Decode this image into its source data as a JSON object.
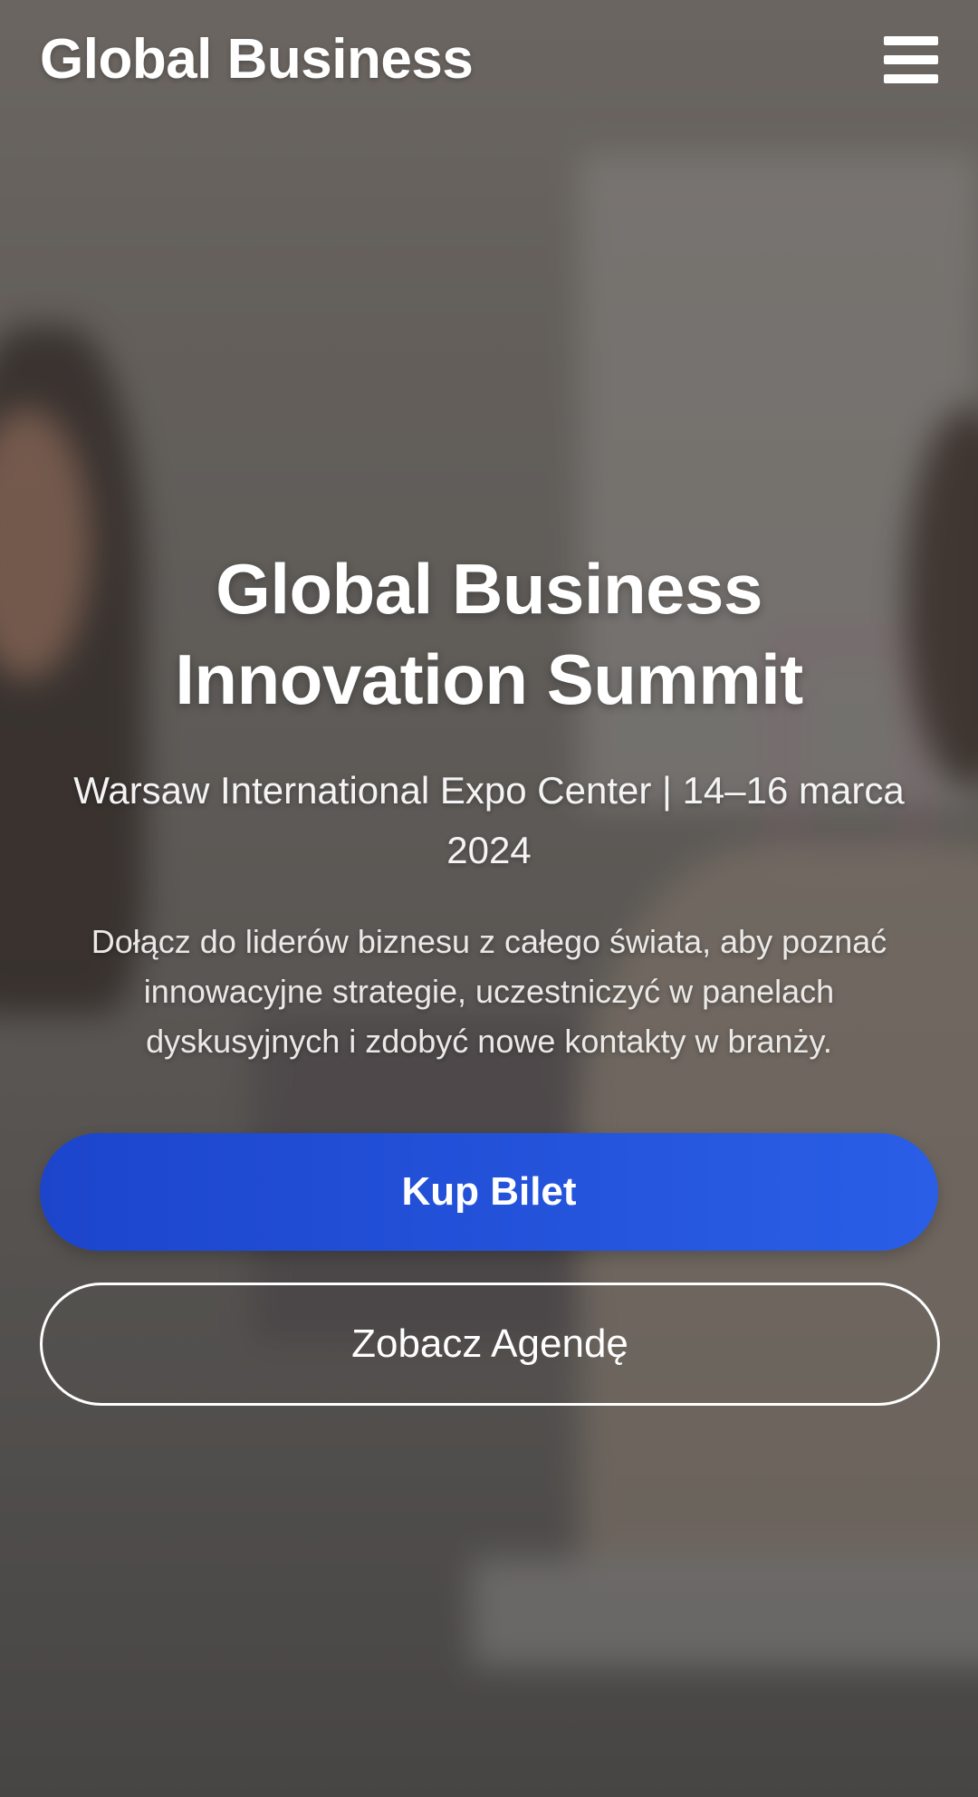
{
  "header": {
    "brand": "Global Business",
    "menu_icon": "hamburger-menu-icon"
  },
  "hero": {
    "title_line1": "Global Business",
    "title_line2": "Innovation Summit",
    "subtitle": "Warsaw International Expo Center | 14–16 marca 2024",
    "description": "Dołącz do liderów biznesu z całego świata, aby poznać innowacyjne strategie, uczestniczyć w panelach dyskusyjnych i zdobyć nowe kontakty w branży.",
    "primary_button": "Kup Bilet",
    "secondary_button": "Zobacz Agendę"
  },
  "colors": {
    "primary_button": "#2352dc",
    "text": "#ffffff"
  }
}
